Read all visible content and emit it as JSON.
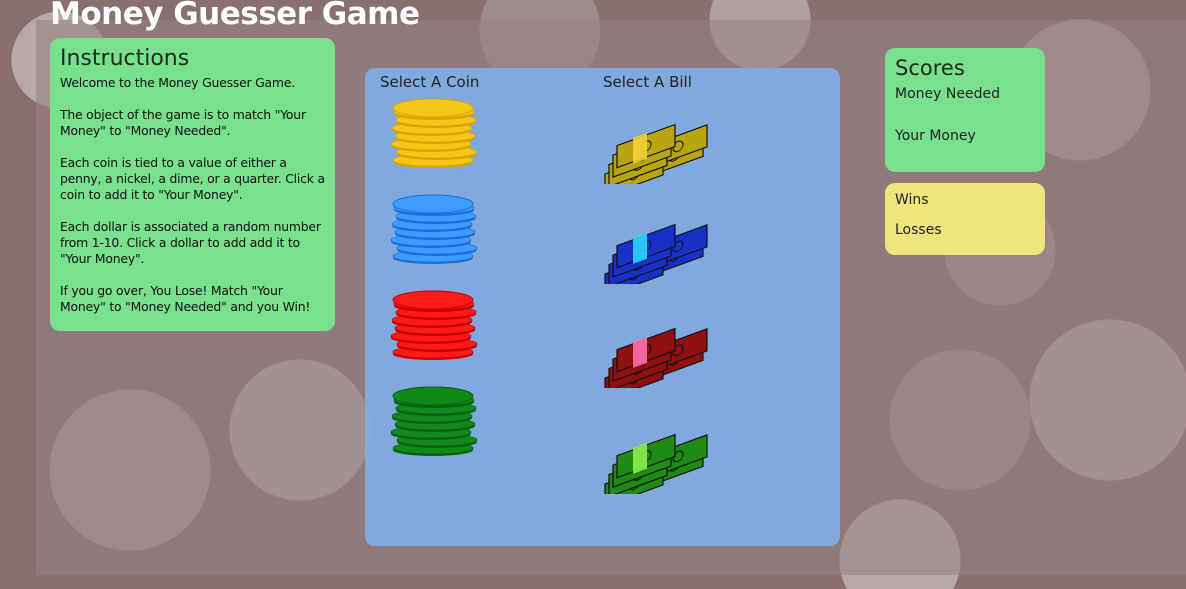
{
  "app": {
    "title": "Money Guesser Game"
  },
  "instructions": {
    "heading": "Instructions",
    "paragraphs": [
      "Welcome to the Money Guesser Game.",
      "The object of the game is to match \"Your Money\" to \"Money Needed\".",
      "Each coin is tied to a value of either a penny, a nickel, a dime, or a quarter. Click a coin to add it to \"Your Money\".",
      "Each dollar is associated a random number from 1-10. Click a dollar to add add it to \"Your Money\".",
      "If you go over, You Lose! Match \"Your Money\" to \"Money Needed\" and you Win!"
    ]
  },
  "play": {
    "coin_label": "Select A Coin",
    "bill_label": "Select A Bill",
    "coins": [
      {
        "icon": "yellow-coin-stack-icon",
        "color": "#f5c518",
        "edge": "#d9a300"
      },
      {
        "icon": "blue-coin-stack-icon",
        "color": "#3d9cff",
        "edge": "#1e6fd1"
      },
      {
        "icon": "red-coin-stack-icon",
        "color": "#ff1a1a",
        "edge": "#c40000"
      },
      {
        "icon": "green-coin-stack-icon",
        "color": "#0f8a18",
        "edge": "#066010"
      }
    ],
    "bills": [
      {
        "icon": "yellow-bill-stack-icon",
        "color": "#b9a411",
        "band": "#f3d03a"
      },
      {
        "icon": "blue-bill-stack-icon",
        "color": "#1830c8",
        "band": "#2ad6ff"
      },
      {
        "icon": "red-bill-stack-icon",
        "color": "#8e1010",
        "band": "#ff6fb0"
      },
      {
        "icon": "green-bill-stack-icon",
        "color": "#1f8a16",
        "band": "#8cf04a"
      }
    ]
  },
  "scores": {
    "heading": "Scores",
    "money_needed_label": "Money Needed",
    "your_money_label": "Your Money"
  },
  "record": {
    "wins_label": "Wins",
    "losses_label": "Losses"
  }
}
